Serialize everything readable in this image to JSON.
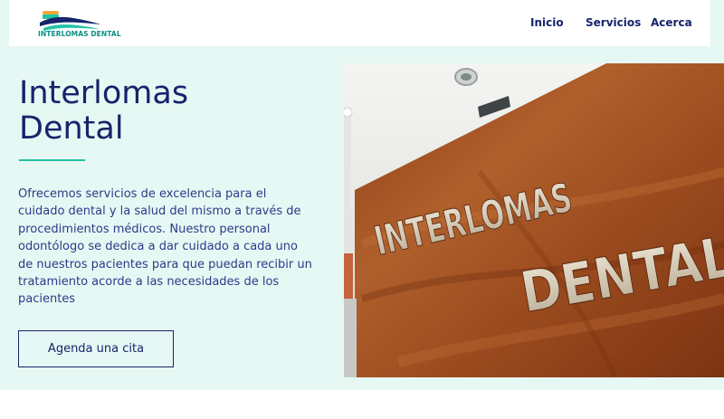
{
  "header": {
    "logo_text": "INTERLOMAS DENTAL",
    "nav": [
      {
        "label": "Inicio"
      },
      {
        "label": "Servicios"
      },
      {
        "label": "Acerca"
      }
    ]
  },
  "hero": {
    "title_line1": "Interlomas",
    "title_line2": "Dental",
    "description": "Ofrecemos servicios de excelencia para el cuidado dental y la salud del mismo a través de procedimientos médicos. Nuestro personal odontólogo se dedica a dar cuidado a cada uno de nuestros pacientes para que puedan recibir un tratamiento acorde a las necesidades de los pacientes",
    "cta_label": "Agenda una cita"
  },
  "photo": {
    "sign_line1": "INTERLOMAS",
    "sign_line2": "DENTAL"
  },
  "colors": {
    "navy": "#16246b",
    "teal": "#21c3a3",
    "mint_background": "#e6f8f3",
    "wood": "#9a4a1f"
  }
}
